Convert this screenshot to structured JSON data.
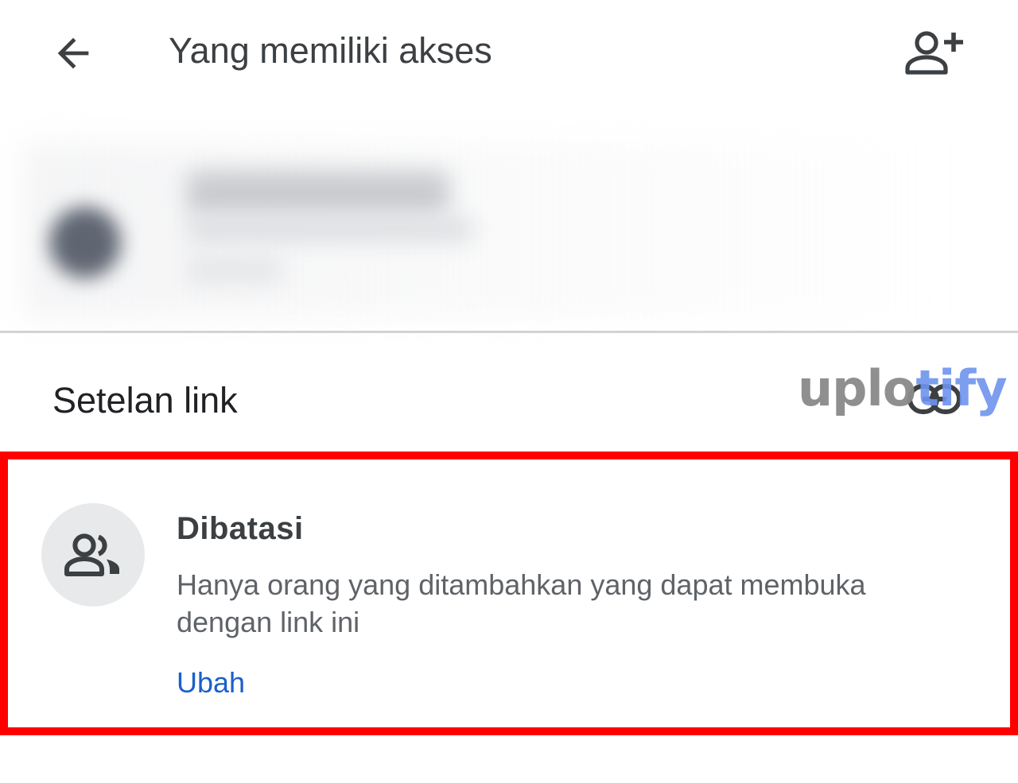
{
  "header": {
    "title": "Yang memiliki akses",
    "back_icon": "arrow-left-icon",
    "add_person_icon": "person-add-icon"
  },
  "link_settings": {
    "title": "Setelan link",
    "icon": "link-icon"
  },
  "access": {
    "icon": "people-icon",
    "title": "Dibatasi",
    "description": "Hanya orang yang ditambahkan yang dapat membuka dengan link ini",
    "change_label": "Ubah"
  },
  "watermark": {
    "part1": "uplo",
    "part2": "tify"
  },
  "colors": {
    "highlight": "#ff0000",
    "link": "#1a5fcb",
    "watermark_gray": "#8a8a8a",
    "watermark_blue": "#6f94ee"
  }
}
